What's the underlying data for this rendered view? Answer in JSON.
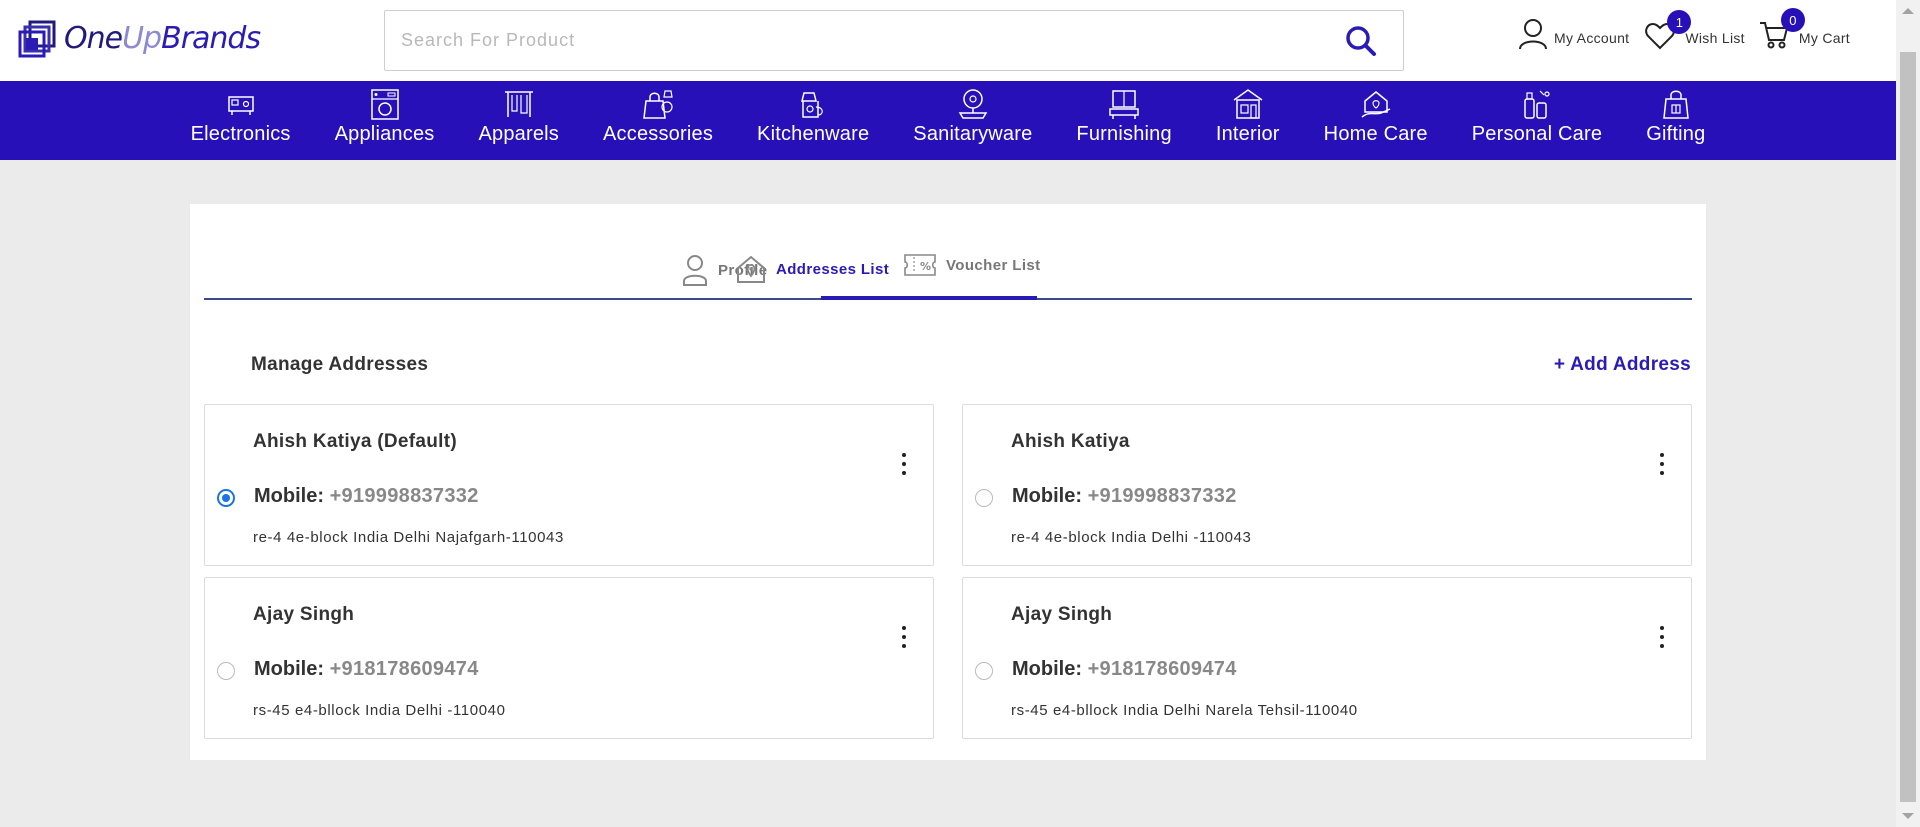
{
  "header": {
    "logo": {
      "one": "One",
      "up": "Up",
      "brands": "Brands"
    },
    "search": {
      "placeholder": "Search For Product",
      "value": ""
    },
    "my_account": "My Account",
    "wish_list": "Wish List",
    "wish_count": "1",
    "my_cart": "My Cart",
    "cart_count": "0"
  },
  "categories": [
    "Electronics",
    "Appliances",
    "Apparels",
    "Accessories",
    "Kitchenware",
    "Sanitaryware",
    "Furnishing",
    "Interior",
    "Home Care",
    "Personal Care",
    "Gifting"
  ],
  "tabs": {
    "profile": "Profile",
    "addresses": "Addresses List",
    "voucher": "Voucher List",
    "active": "addresses"
  },
  "addresses": {
    "title": "Manage Addresses",
    "add_label": "+ Add Address",
    "mobile_label": "Mobile:",
    "items": [
      {
        "name": "Ahish Katiya (Default)",
        "mobile": "+919998837332",
        "address": "re-4 4e-block India Delhi Najafgarh-110043",
        "selected": true
      },
      {
        "name": "Ahish Katiya",
        "mobile": "+919998837332",
        "address": "re-4 4e-block India Delhi -110043",
        "selected": false
      },
      {
        "name": "Ajay Singh",
        "mobile": "+918178609474",
        "address": "rs-45 e4-bllock India Delhi -110040",
        "selected": false
      },
      {
        "name": "Ajay Singh",
        "mobile": "+918178609474",
        "address": "rs-45 e4-bllock India Delhi Narela Tehsil-110040",
        "selected": false
      }
    ]
  },
  "colors": {
    "brand": "#2710b8",
    "link": "#2a1bb5",
    "radio": "#1a73e8"
  }
}
